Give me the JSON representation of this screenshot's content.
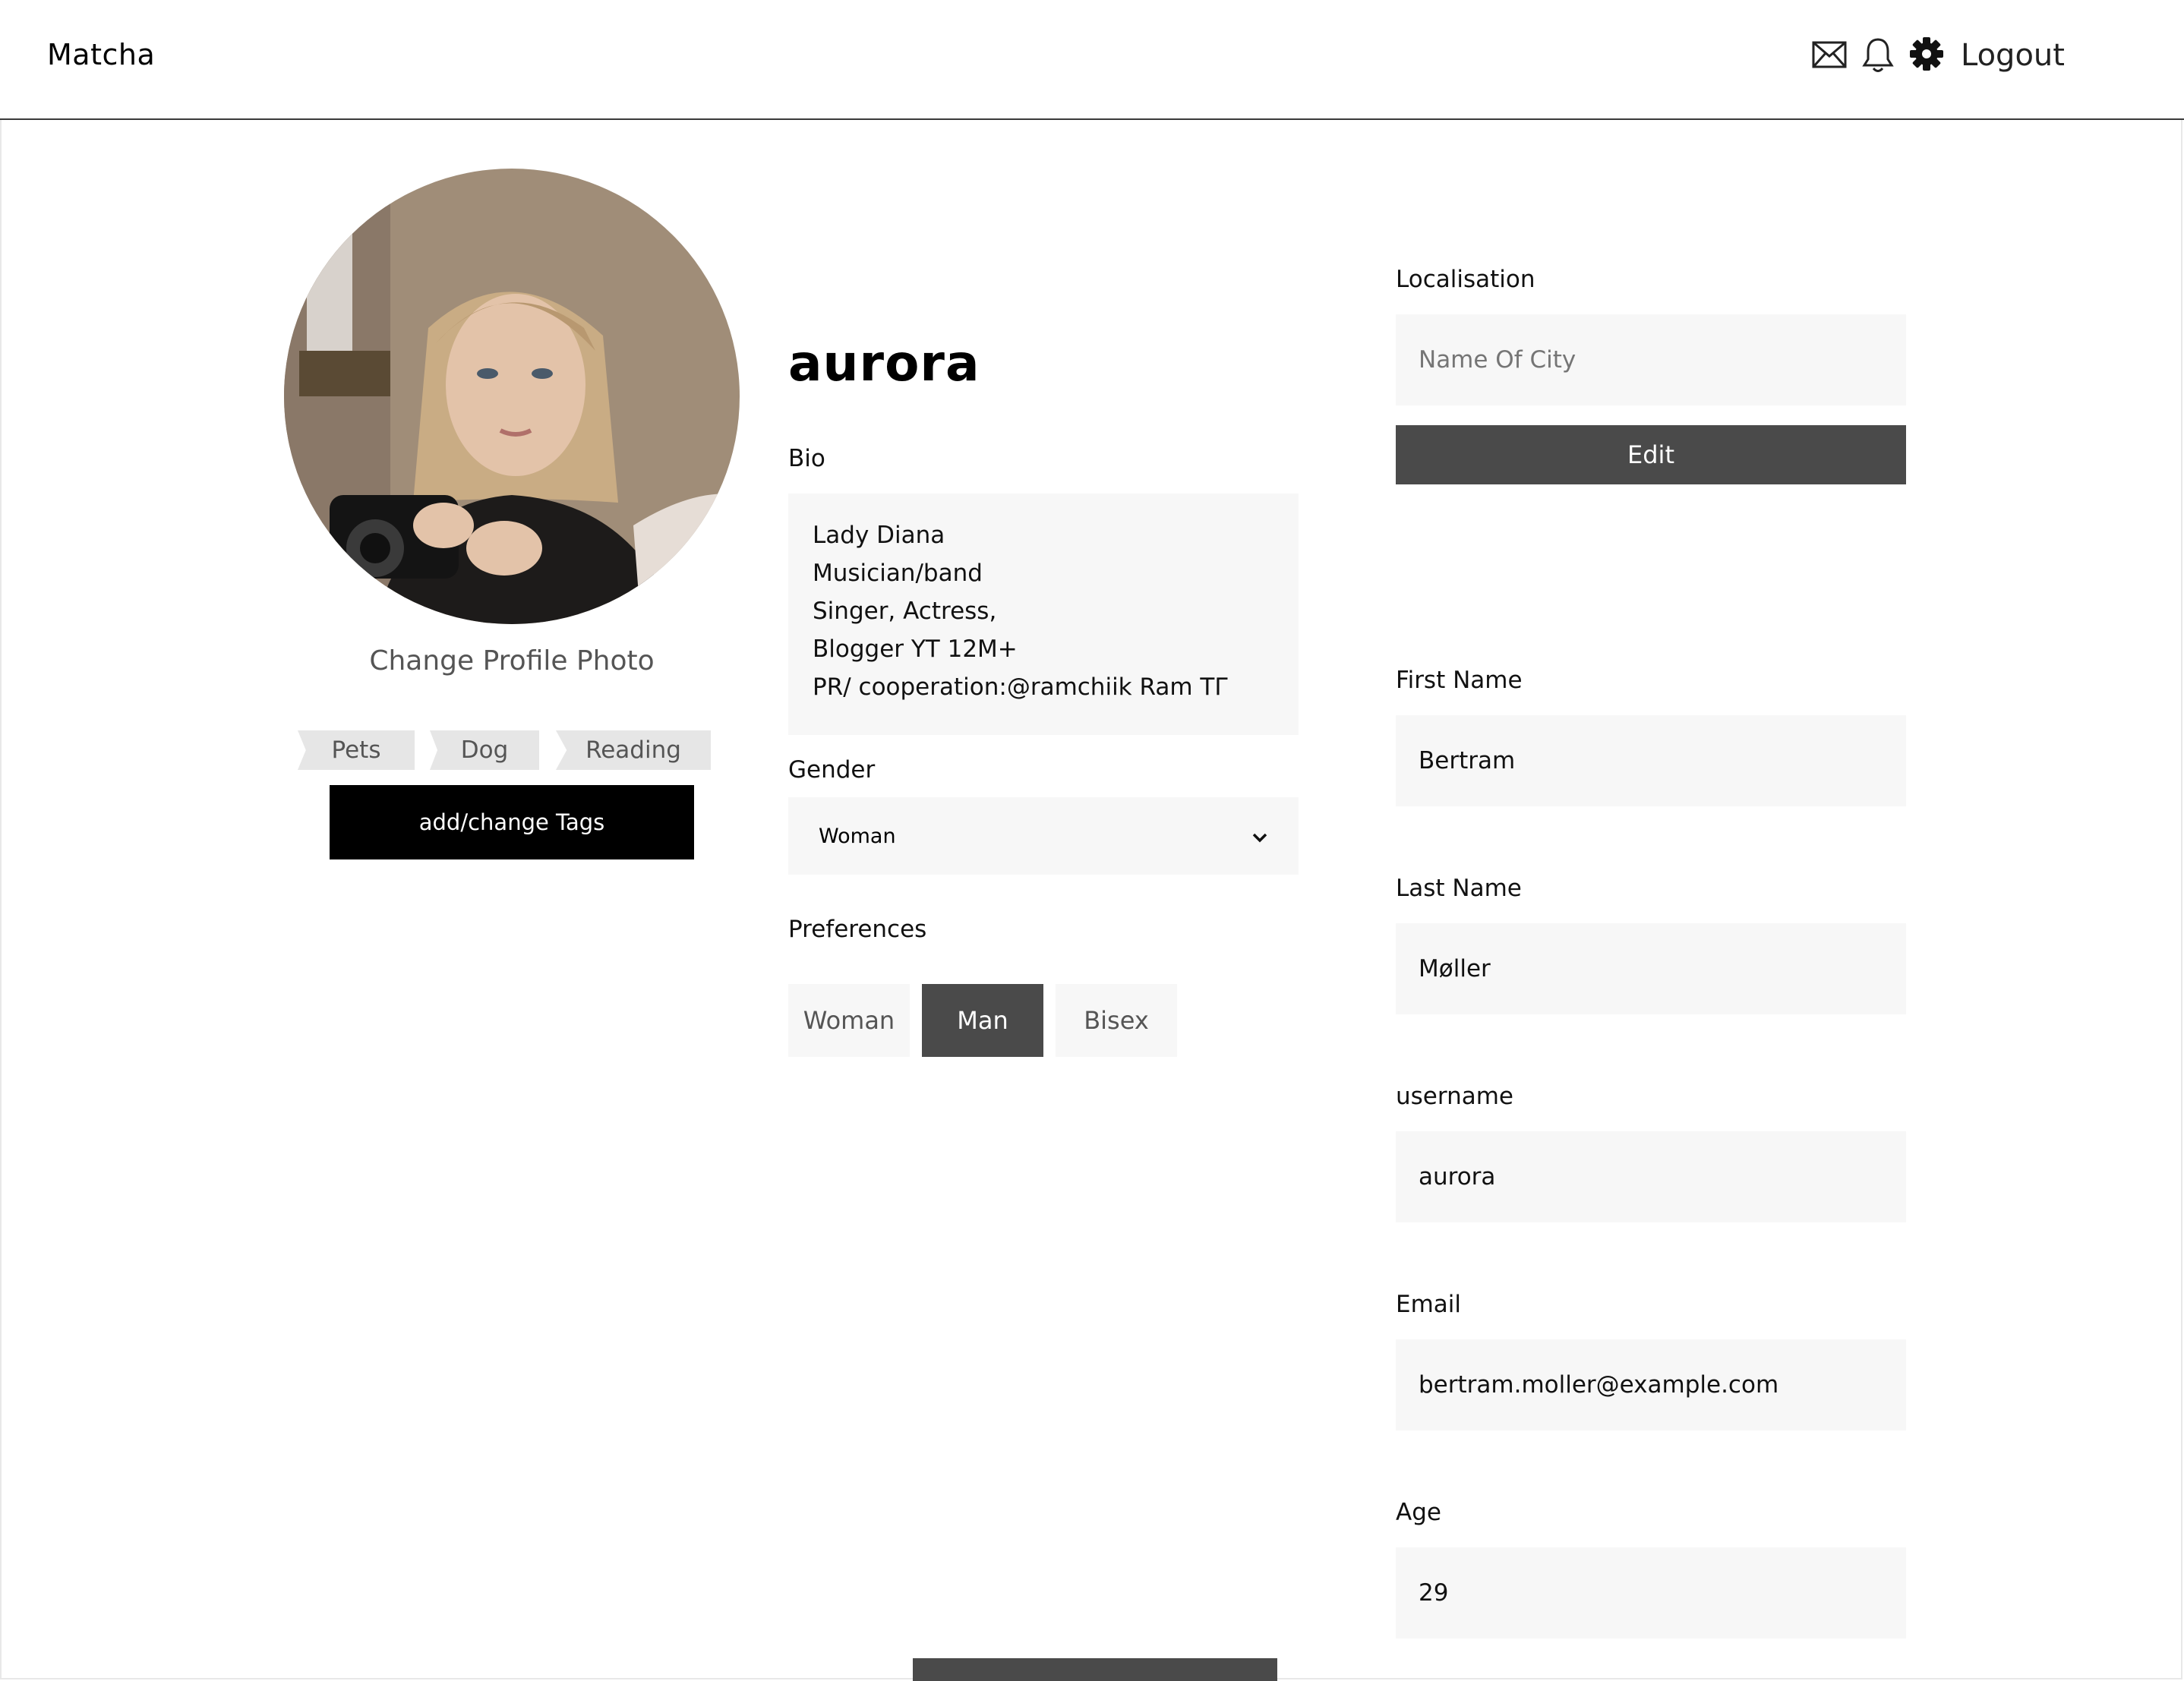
{
  "header": {
    "brand": "Matcha",
    "icons": [
      "mail-icon",
      "bell-icon",
      "gear-icon"
    ],
    "logout_label": "Logout"
  },
  "profile": {
    "username_title": "aurora",
    "change_photo_label": "Change Profile Photo",
    "tags": [
      "Pets",
      "Dog",
      "Reading"
    ],
    "tags_button_label": "add/change Tags",
    "bio_label": "Bio",
    "bio_lines": [
      "Lady Diana",
      "Musician/band",
      "Singer, Actress,",
      "Blogger YT 12M+",
      "PR/ cooperation:@ramchiik Ram TГ"
    ],
    "gender_label": "Gender",
    "gender_value": "Woman",
    "preferences_label": "Preferences",
    "preferences": [
      {
        "label": "Woman",
        "selected": false
      },
      {
        "label": "Man",
        "selected": true
      },
      {
        "label": "Bisex",
        "selected": false
      }
    ]
  },
  "details": {
    "localisation_label": "Localisation",
    "city_placeholder": "Name Of City",
    "edit_label": "Edit",
    "first_name_label": "First Name",
    "first_name_value": "Bertram",
    "last_name_label": "Last Name",
    "last_name_value": "Møller",
    "username_label": "username",
    "username_value": "aurora",
    "email_label": "Email",
    "email_value": "bertram.moller@example.com",
    "age_label": "Age",
    "age_value": "29"
  },
  "colors": {
    "accent_dark": "#4a4a4a",
    "field_bg": "#f7f7f7",
    "tag_bg": "#e6e6e6"
  }
}
